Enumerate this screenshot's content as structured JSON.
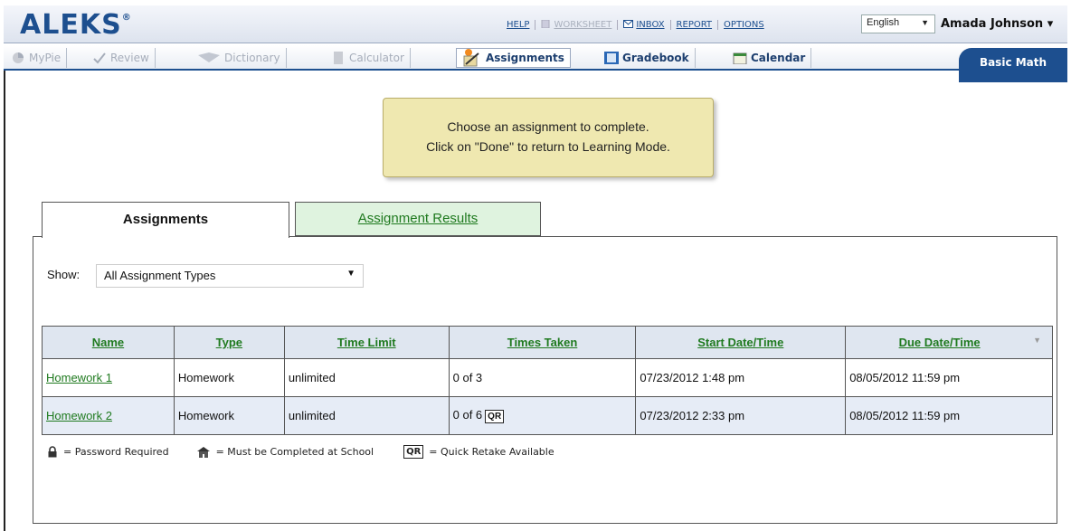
{
  "header": {
    "logo": "ALEKS",
    "logo_mark": "®",
    "links": [
      {
        "label": "HELP",
        "disabled": false
      },
      {
        "label": "WORKSHEET",
        "disabled": true
      },
      {
        "label": "INBOX",
        "disabled": false
      },
      {
        "label": "REPORT",
        "disabled": false
      },
      {
        "label": "OPTIONS",
        "disabled": false
      }
    ],
    "language": "English",
    "user": "Amada Johnson ▾"
  },
  "toolbar": {
    "items": [
      {
        "label": "MyPie",
        "icon": "pie-icon",
        "disabled": true
      },
      {
        "label": "Review",
        "icon": "check-icon",
        "disabled": true
      },
      {
        "label": "Dictionary",
        "icon": "book-icon",
        "disabled": true
      },
      {
        "label": "Calculator",
        "icon": "calculator-icon",
        "disabled": true
      },
      {
        "label": "Assignments",
        "icon": "assignments-icon",
        "disabled": false,
        "active": true
      },
      {
        "label": "Gradebook",
        "icon": "gradebook-icon",
        "disabled": false
      },
      {
        "label": "Calendar",
        "icon": "calendar-icon",
        "disabled": false
      }
    ],
    "course": "Basic Math"
  },
  "message": {
    "line1": "Choose an assignment to complete.",
    "line2": "Click on \"Done\" to return to Learning Mode."
  },
  "tabs": {
    "assignments": "Assignments",
    "results": "Assignment Results"
  },
  "filter": {
    "label": "Show:",
    "value": "All Assignment Types"
  },
  "table": {
    "headers": [
      "Name",
      "Type",
      "Time Limit",
      "Times Taken",
      "Start Date/Time",
      "Due Date/Time"
    ],
    "rows": [
      {
        "name": "Homework 1",
        "type": "Homework",
        "time_limit": "unlimited",
        "times_taken": "0 of 3",
        "quick_retake": false,
        "start": "07/23/2012   1:48 pm",
        "due": "08/05/2012  11:59 pm"
      },
      {
        "name": "Homework 2",
        "type": "Homework",
        "time_limit": "unlimited",
        "times_taken": "0 of 6",
        "quick_retake": true,
        "qr_label": "QR",
        "start": "07/23/2012   2:33 pm",
        "due": "08/05/2012  11:59 pm"
      }
    ]
  },
  "legend": {
    "password": "= Password Required",
    "school": "= Must be Completed at School",
    "qr_badge": "QR",
    "qr": "= Quick Retake Available"
  },
  "colors": {
    "brand": "#1d4f8f",
    "link_green": "#1f7a1f",
    "message_bg": "#efe8b0"
  }
}
